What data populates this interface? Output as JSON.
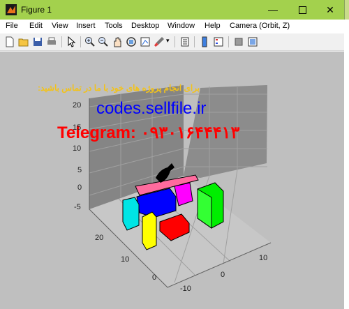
{
  "window": {
    "title": "Figure 1",
    "minimize_icon": "minimize-icon",
    "maximize_icon": "maximize-icon",
    "close_icon": "close-icon"
  },
  "menu": [
    "File",
    "Edit",
    "View",
    "Insert",
    "Tools",
    "Desktop",
    "Window",
    "Help",
    "Camera (Orbit, Z)"
  ],
  "toolbar_icons": [
    "new-figure-icon",
    "open-file-icon",
    "save-icon",
    "print-icon",
    "pointer-icon",
    "zoom-in-icon",
    "zoom-out-icon",
    "pan-icon",
    "rotate-icon",
    "data-cursor-icon",
    "brush-icon",
    "link-icon",
    "insert-colorbar-icon",
    "insert-legend-icon",
    "hide-plot-tools-icon",
    "show-plot-tools-icon"
  ],
  "overlay": {
    "persian_line": "برای انجام پروژه های خود با ما در تماس باشید:",
    "site": "codes.sellfile.ir",
    "telegram": "Telegram: ۰۹۳۰۱۶۴۴۴۱۳"
  },
  "axes": {
    "z_ticks": [
      "20",
      "15",
      "10",
      "5",
      "0",
      "-5"
    ],
    "y_ticks": [
      "20",
      "10",
      "0",
      "-10"
    ],
    "x_ticks": [
      "10",
      "0"
    ]
  },
  "colors": {
    "title_bar": "#a3d14d",
    "axes_bg": "#808080",
    "canvas": "#bfbfbf",
    "persian_text": "#f2c21b",
    "site_text": "#0000ff",
    "telegram_text": "#ff0000"
  }
}
